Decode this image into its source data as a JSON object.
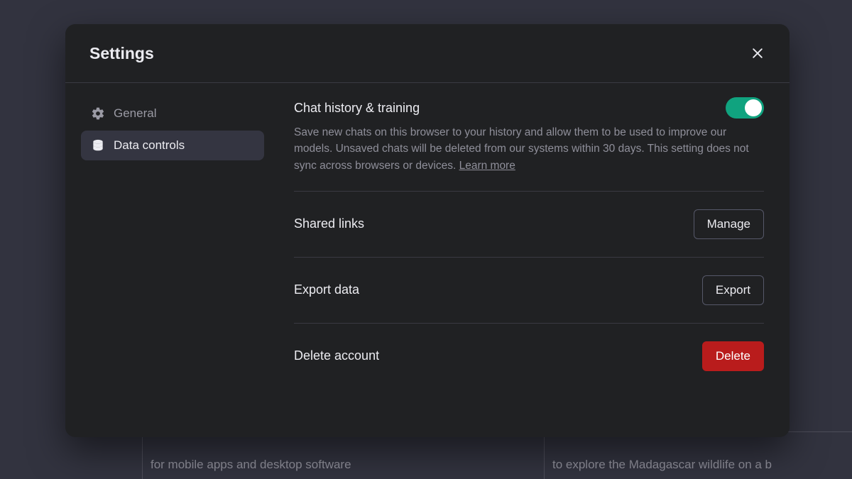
{
  "modal": {
    "title": "Settings"
  },
  "sidebar": {
    "items": [
      {
        "label": "General"
      },
      {
        "label": "Data controls"
      }
    ]
  },
  "content": {
    "chat_history": {
      "title": "Chat history & training",
      "description": "Save new chats on this browser to your history and allow them to be used to improve our models. Unsaved chats will be deleted from our systems within 30 days. This setting does not sync across browsers or devices. ",
      "learn_more": "Learn more"
    },
    "shared_links": {
      "label": "Shared links",
      "button": "Manage"
    },
    "export_data": {
      "label": "Export data",
      "button": "Export"
    },
    "delete_account": {
      "label": "Delete account",
      "button": "Delete"
    }
  },
  "background": {
    "snippet_left": "for mobile apps and desktop software",
    "snippet_right": "to explore the Madagascar wildlife on a b"
  }
}
